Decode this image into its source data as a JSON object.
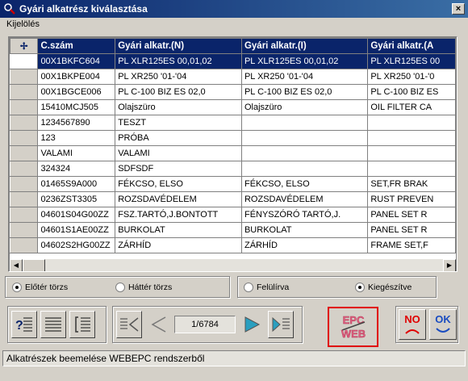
{
  "window": {
    "title": "Gyári alkatrész kiválasztása",
    "close_label": "×"
  },
  "menu": {
    "items": [
      "Kijelölés"
    ]
  },
  "table": {
    "indicator_header": "✢",
    "columns": [
      "C.szám",
      "Gyári alkatr.(N)",
      "Gyári alkatr.(I)",
      "Gyári alkatr.(A"
    ],
    "rows": [
      [
        "00X1BKFC604",
        "PL XLR125ES 00,01,02",
        "PL XLR125ES 00,01,02",
        "PL XLR125ES 00"
      ],
      [
        "00X1BKPE004",
        "PL XR250 '01-'04",
        "PL XR250 '01-'04",
        "PL XR250 '01-'0"
      ],
      [
        "00X1BGCE006",
        "PL C-100 BIZ ES 02,0",
        "PL C-100 BIZ ES 02,0",
        "PL C-100 BIZ ES"
      ],
      [
        "15410MCJ505",
        "Olajszüro",
        "Olajszüro",
        "OIL FILTER CA"
      ],
      [
        "1234567890",
        "TESZT",
        "",
        ""
      ],
      [
        "123",
        "PRÓBA",
        "",
        ""
      ],
      [
        "VALAMI",
        "VALAMI",
        "",
        ""
      ],
      [
        "324324",
        "SDFSDF",
        "",
        ""
      ],
      [
        "01465S9A000",
        "FÉKCSO, ELSO",
        "FÉKCSO, ELSO",
        "SET,FR BRAK"
      ],
      [
        "0236ZST3305",
        "ROZSDAVÉDELEM",
        "ROZSDAVÉDELEM",
        "RUST PREVEN"
      ],
      [
        "04601S04G00ZZ",
        "FSZ.TARTÓ,J.BONTOTT",
        "FÉNYSZÓRÓ TARTÓ,J.",
        "PANEL SET R"
      ],
      [
        "04601S1AE00ZZ",
        "BURKOLAT",
        "BURKOLAT",
        "PANEL SET R"
      ],
      [
        "04602S2HG00ZZ",
        "ZÁRHÍD",
        "ZÁRHÍD",
        "FRAME SET,F"
      ]
    ],
    "selected_row": 0
  },
  "options": {
    "elotert": "Előtér törzs",
    "hattert": "Háttér törzs",
    "felulirva": "Felülírva",
    "kiegeszitve": "Kiegészítve",
    "selected_left": "elotert",
    "selected_right": "kiegeszitve"
  },
  "nav": {
    "counter": "1/6784"
  },
  "epc": {
    "line1": "EPC",
    "line2": "WEB",
    "highlight_color": "#e00000"
  },
  "dialog": {
    "no_label": "NO",
    "ok_label": "OK"
  },
  "status": {
    "text": "Alkatrészek beemelése WEBEPC rendszerből"
  }
}
